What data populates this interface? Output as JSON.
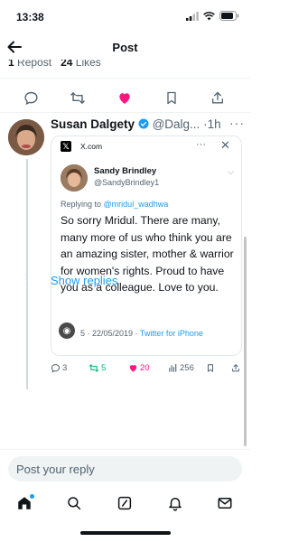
{
  "status_bar": {
    "time": "13:38"
  },
  "header": {
    "title": "Post"
  },
  "stats": {
    "reposts_count": "1",
    "reposts_label": "Repost",
    "likes_count": "24",
    "likes_label": "Likes"
  },
  "reply": {
    "author_name": "Susan Dalgety",
    "author_handle": "@Dalg...",
    "separator": "·",
    "time": "1h",
    "more": "···",
    "embedded": {
      "site": "X.com",
      "author_name": "Sandy Brindley",
      "author_handle": "@SandyBrindley1",
      "replying_prefix": "Replying to",
      "replying_to": "@mridul_wadhwa",
      "text": "So sorry Mridul. There are many, many more of us who think you are an amazing sister, mother & warrior for women's rights. Proud to have you as a colleague. Love to you.",
      "meta_time": "5 · 22/05/2019 ·",
      "meta_source": "Twitter for iPhone"
    },
    "actions": {
      "replies": "3",
      "reposts": "5",
      "likes": "20",
      "views": "256"
    }
  },
  "show_replies": "Show replies",
  "composer": {
    "placeholder": "Post your reply"
  },
  "colors": {
    "accent": "#1d9bf0",
    "like": "#f91880",
    "repost": "#00ba7c",
    "text": "#0f1419",
    "muted": "#536471"
  }
}
